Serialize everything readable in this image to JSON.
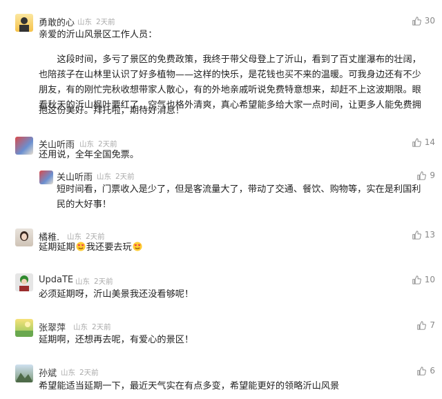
{
  "comments": [
    {
      "username": "勇敢的心",
      "location": "山东",
      "time": "2天前",
      "likes": "30",
      "avatar": "avatar-1",
      "greeting": "亲爱的沂山风景区工作人员：",
      "lines": [
        "　　这段时间，多亏了景区的免费政策，我终于带父母登上了沂山，看到了百丈崖瀑布的壮阔，",
        "也陪孩子在山林里认识了好多植物——这样的快乐，是花钱也买不来的温暖。可我身边还有不少",
        "朋友，有的刚忙完秋收想带家人散心，有的外地亲戚听说免费特意想来，却赶不上这波期限。眼",
        "看秋天的沂山枫叶要红了，空气也格外清爽，真心希望能多给大家一点时间，让更多人能免费拥",
        "抱这份美好。拜托啦，期待好消息！"
      ]
    },
    {
      "username": "关山听雨",
      "location": "山东",
      "time": "2天前",
      "likes": "14",
      "text": "还用说，全年全国免票。",
      "reply": {
        "username": "关山听雨",
        "location": "山东",
        "time": "2天前",
        "likes": "9",
        "lines": [
          "短时间看，门票收入是少了，但是客流量大了，带动了交通、餐饮、购物等，实在是利国利",
          "民的大好事！"
        ]
      }
    },
    {
      "username": "橘稚.",
      "location": "山东",
      "time": "2天前",
      "likes": "13",
      "text_a": "延期延期",
      "text_b": "我还要去玩",
      "emoji": "heart-eyes"
    },
    {
      "username": "UpdaTE",
      "location": "山东",
      "time": "2天前",
      "likes": "10",
      "text": "必须延期呀，沂山美景我还没看够呢！"
    },
    {
      "username": "张翠萍",
      "location": "山东",
      "time": "2天前",
      "likes": "7",
      "text": "延期啊，还想再去呢，有爱心的景区！"
    },
    {
      "username": "孙斌",
      "location": "山东",
      "time": "2天前",
      "likes": "6",
      "text": "希望能适当延期一下，最近天气实在有点多变，希望能更好的领略沂山风景"
    }
  ],
  "colors": {
    "text": "#222222",
    "meta": "#aaaaaa",
    "likes": "#888888"
  }
}
